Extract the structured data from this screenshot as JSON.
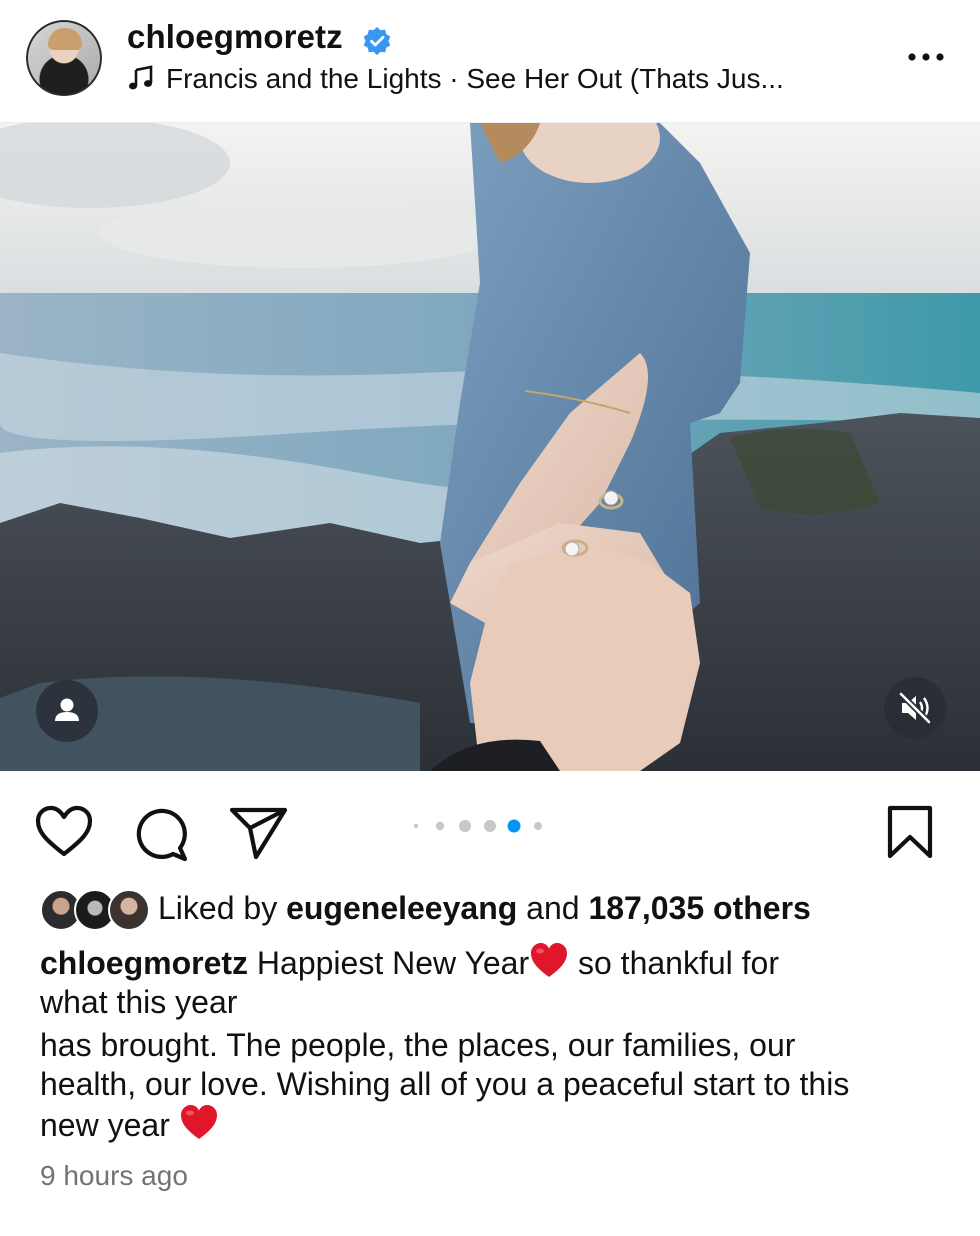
{
  "header": {
    "username": "chloegmoretz",
    "verified_icon": "verified-badge-icon",
    "audio_label": "Francis and the Lights · See Her Out (Thats Jus...",
    "more_icon": "more-options-icon"
  },
  "media": {
    "description_icon": "user-tag-icon",
    "mute_icon": "mute-icon",
    "carousel": {
      "total": 6,
      "active_index": 4
    }
  },
  "actions": {
    "like_icon": "heart-icon",
    "comment_icon": "comment-icon",
    "share_icon": "send-icon",
    "save_icon": "bookmark-icon"
  },
  "likes": {
    "prefix": "Liked by ",
    "user": "eugeneleeyang",
    "middle": " and ",
    "count": "187,035 others"
  },
  "caption": {
    "username": "chloegmoretz",
    "line1_a": " Happiest New Year",
    "line1_b": " so thankful for",
    "line2": "what this year",
    "line3": "has brought. The people, the places, our families, our",
    "line4": "health, our love. Wishing all of you a peaceful start to this",
    "line5": "new year "
  },
  "timestamp": "9 hours ago",
  "colors": {
    "verified": "#3897f0",
    "dot_active": "#0095f6",
    "dot_inactive": "#c7c7c7",
    "heart_emoji": "#e0162b"
  }
}
